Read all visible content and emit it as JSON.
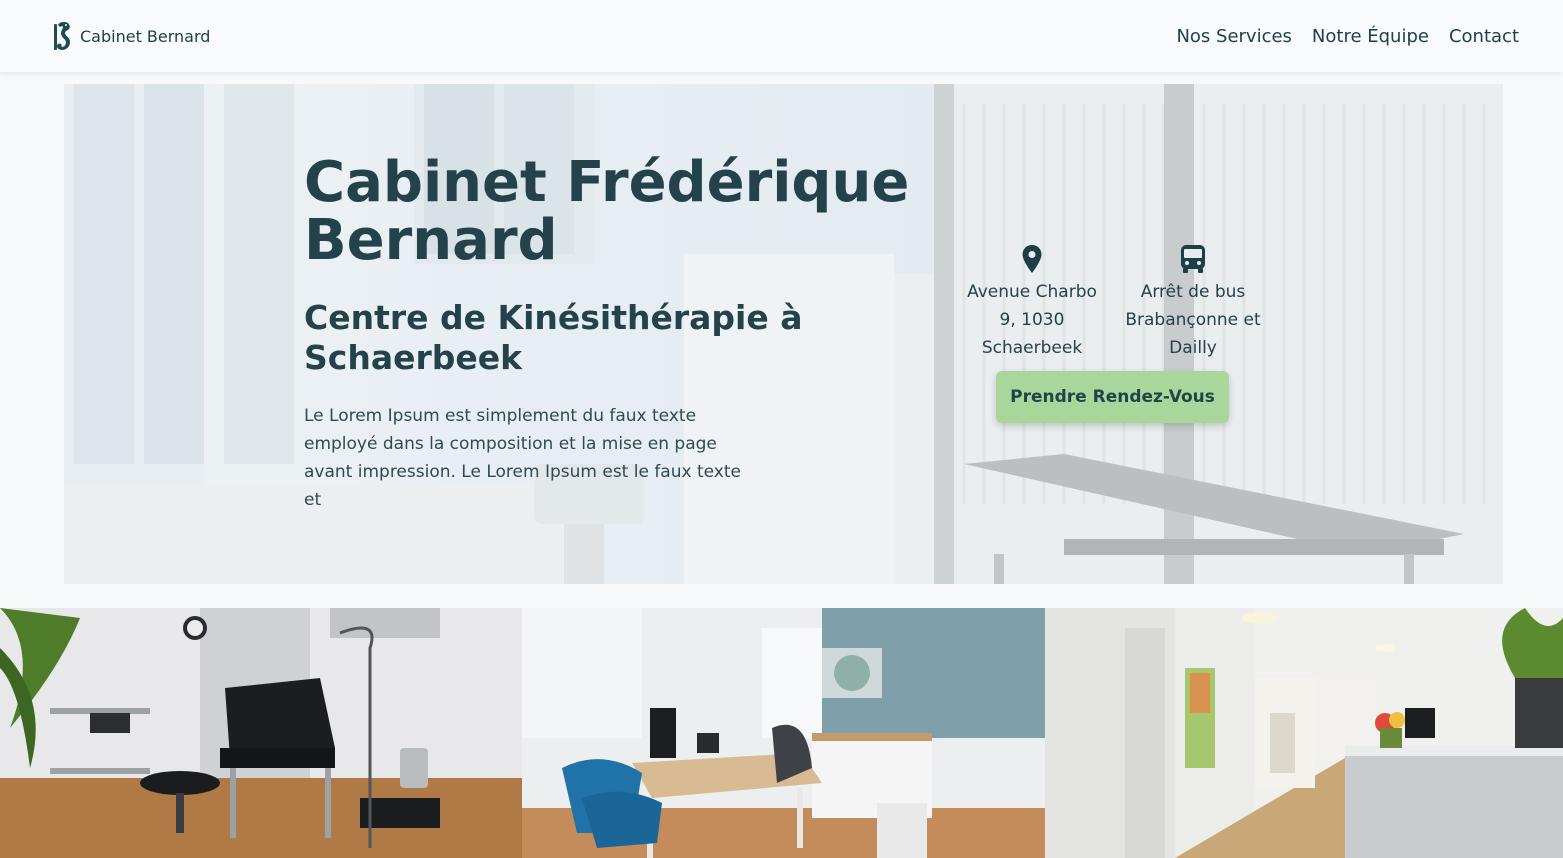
{
  "header": {
    "brand_name": "Cabinet Bernard",
    "logo_icon": "seahorse-logo-icon",
    "nav": [
      "Nos Services",
      "Notre Équipe",
      "Contact"
    ]
  },
  "hero": {
    "title": "Cabinet Frédérique Bernard",
    "subtitle": "Centre de Kinésithérapie à Schaerbeek",
    "text": "Le Lorem Ipsum est simplement du faux texte employé dans la composition et la mise en page avant impression. Le Lorem Ipsum est le faux texte et",
    "address": {
      "icon": "map-pin-icon",
      "text": "Avenue Charbo 9, 1030 Schaerbeek"
    },
    "bus": {
      "icon": "bus-icon",
      "text": "Arrêt de bus Brabançonne et Dailly"
    },
    "cta_label": "Prendre Rendez-Vous"
  },
  "gallery": [
    {
      "alt": "examination-room-photo"
    },
    {
      "alt": "office-desk-photo"
    },
    {
      "alt": "reception-hallway-photo"
    }
  ],
  "colors": {
    "text": "#24424a",
    "accent": "#a9d79b",
    "background": "#f7f9fb"
  }
}
